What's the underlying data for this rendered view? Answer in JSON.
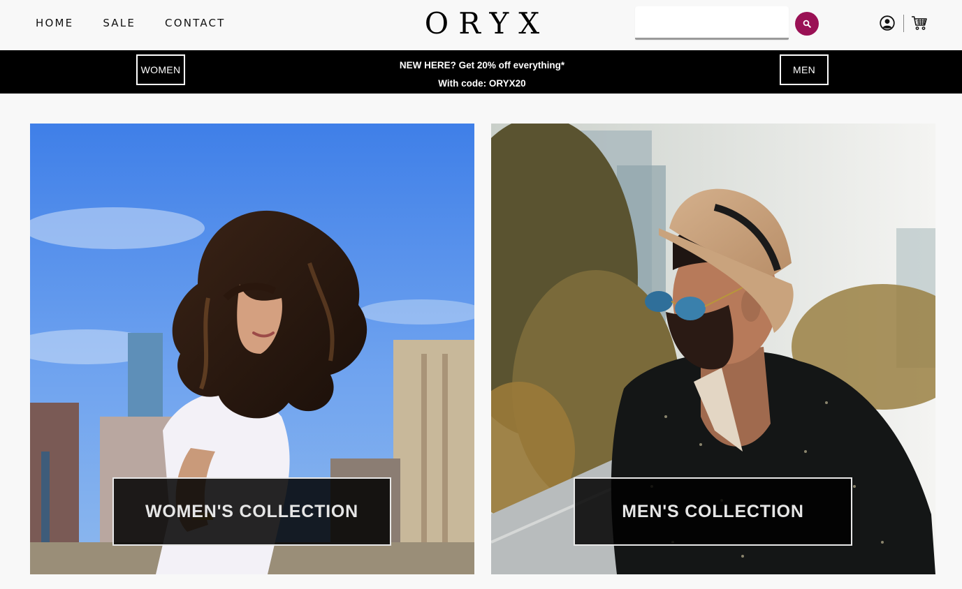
{
  "header": {
    "nav": [
      "HOME",
      "SALE",
      "CONTACT"
    ],
    "logo": "ORYX",
    "search": {
      "value": "",
      "placeholder": ""
    },
    "icons": {
      "search": "search-icon",
      "account": "user-circle-icon",
      "cart": "shopping-cart-icon"
    }
  },
  "promo": {
    "women_label": "WOMEN",
    "men_label": "MEN",
    "line1": "NEW HERE? Get 20% off everything*",
    "line2": "With code: ORYX20"
  },
  "collections": [
    {
      "label": "WOMEN'S COLLECTION"
    },
    {
      "label": "MEN'S COLLECTION"
    }
  ],
  "colors": {
    "accent": "#9a1155",
    "promo_bg": "#000000",
    "page_bg": "#f8f8f8"
  }
}
